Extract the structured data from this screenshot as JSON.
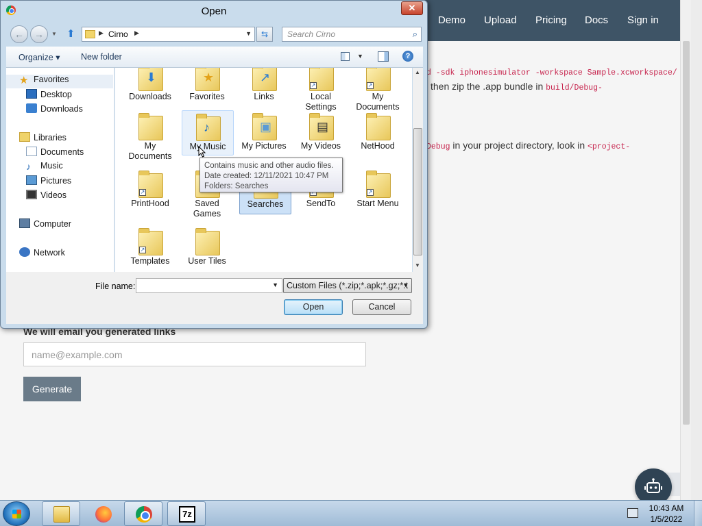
{
  "webpage": {
    "nav": [
      "Demo",
      "Upload",
      "Pricing",
      "Docs",
      "Sign in"
    ],
    "line1_code": "d -sdk iphonesimulator -workspace Sample.xcworkspace/",
    "line2_text": "then zip the .app bundle in",
    "line2_code": "build/Debug-",
    "line3_code": "Debug",
    "line3_text": "in your project directory, look in",
    "line3_code2": "<project-",
    "email_heading": "We will email you generated links",
    "email_placeholder": "name@example.com",
    "generate_label": "Generate"
  },
  "dialog": {
    "title": "Open",
    "close_label": "✕",
    "breadcrumb": "Cirno",
    "search_placeholder": "Search Cirno",
    "toolbar": {
      "organize": "Organize ▾",
      "new_folder": "New folder",
      "help": "?"
    },
    "nav_pane": [
      {
        "label": "Favorites",
        "icon": "star"
      },
      {
        "label": "Desktop",
        "icon": "desktop"
      },
      {
        "label": "Downloads",
        "icon": "downloads"
      },
      {
        "label": "Libraries",
        "icon": "libraries"
      },
      {
        "label": "Documents",
        "icon": "documents"
      },
      {
        "label": "Music",
        "icon": "music"
      },
      {
        "label": "Pictures",
        "icon": "pictures"
      },
      {
        "label": "Videos",
        "icon": "videos"
      },
      {
        "label": "Computer",
        "icon": "computer"
      },
      {
        "label": "Network",
        "icon": "network"
      }
    ],
    "files": [
      {
        "label": "Downloads"
      },
      {
        "label": "Favorites"
      },
      {
        "label": "Links"
      },
      {
        "label": "Local Settings"
      },
      {
        "label": "My Documents"
      },
      {
        "label": "My Documents"
      },
      {
        "label": "My Music"
      },
      {
        "label": "My Pictures"
      },
      {
        "label": "My Videos"
      },
      {
        "label": "NetHood"
      },
      {
        "label": "PrintHood"
      },
      {
        "label": "Saved Games"
      },
      {
        "label": "Searches"
      },
      {
        "label": "SendTo"
      },
      {
        "label": "Start Menu"
      },
      {
        "label": "Templates"
      },
      {
        "label": "User Tiles"
      }
    ],
    "hovered_item": "My Music",
    "selected_item": "Searches",
    "tooltip": {
      "line1": "Contains music and other audio files.",
      "line2": "Date created: 12/11/2021 10:47 PM",
      "line3": "Folders: Searches"
    },
    "file_name_label": "File name:",
    "file_name_value": "",
    "filter": "Custom Files (*.zip;*.apk;*.gz;*.t",
    "open_label": "Open",
    "cancel_label": "Cancel"
  },
  "taskbar": {
    "apps": [
      "Windows Explorer",
      "Firefox",
      "Google Chrome",
      "7-Zip"
    ],
    "time": "10:43 AM",
    "date": "1/5/2022"
  }
}
